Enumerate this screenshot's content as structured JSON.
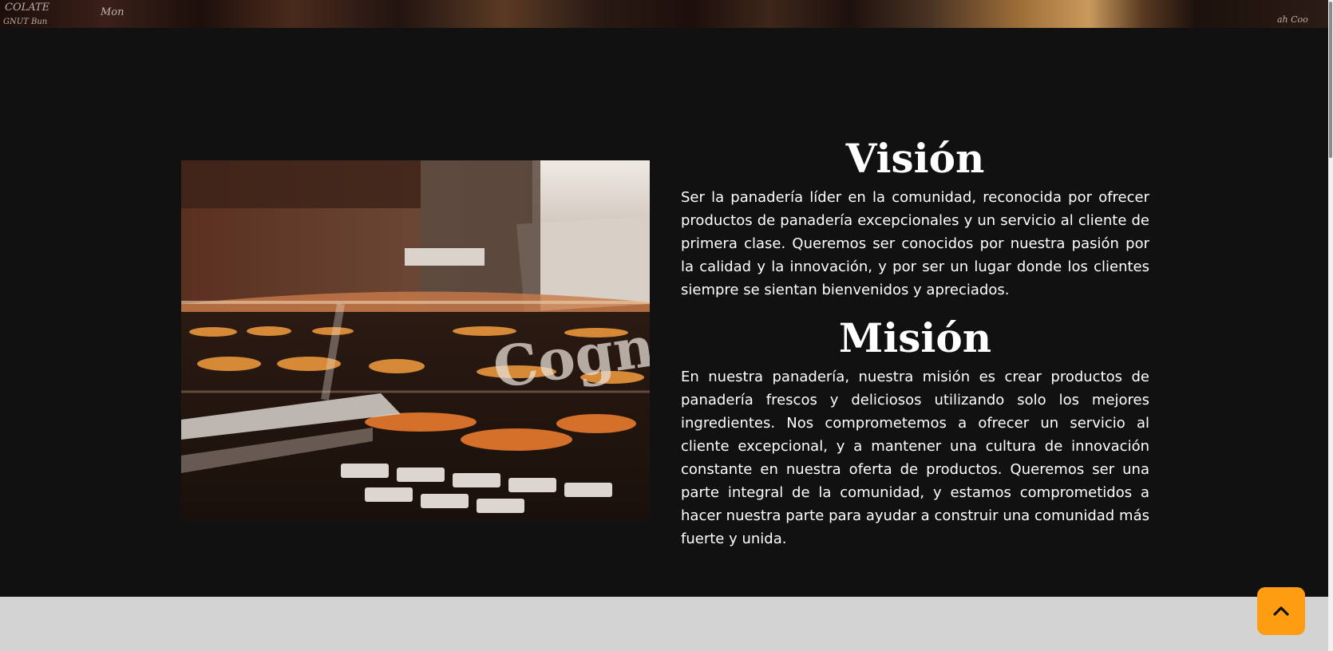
{
  "hero": {
    "chalk_texts": [
      "COLATE",
      "Mon",
      "GNUT Bun",
      "ah Coo"
    ]
  },
  "vision": {
    "title": "Visión",
    "text": "Ser la panadería líder en la comunidad, reconocida por ofrecer productos de panadería excepcionales y un servicio al cliente de primera clase. Queremos ser conocidos por nuestra pasión por la calidad y la innovación, y por ser un lugar donde los clientes siempre se sientan bienvenidos y apreciados."
  },
  "mission": {
    "title": "Misión",
    "text": "En nuestra panadería, nuestra misión es crear productos de panadería frescos y deliciosos utilizando solo los mejores ingredientes. Nos comprometemos a ofrecer un servicio al cliente excepcional, y a mantener una cultura de innovación constante en nuestra oferta de productos. Queremos ser una parte integral de la comunidad, y estamos comprometidos a hacer nuestra parte para ayudar a construir una comunidad más fuerte y unida."
  },
  "photo": {
    "window_lettering": "Cogn"
  },
  "back_to_top": {
    "icon": "chevron-up-icon",
    "color": "#ff9d12"
  },
  "colors": {
    "page_background": "#111111",
    "footer_band": "#d3d3d3",
    "accent": "#ff9d12"
  }
}
